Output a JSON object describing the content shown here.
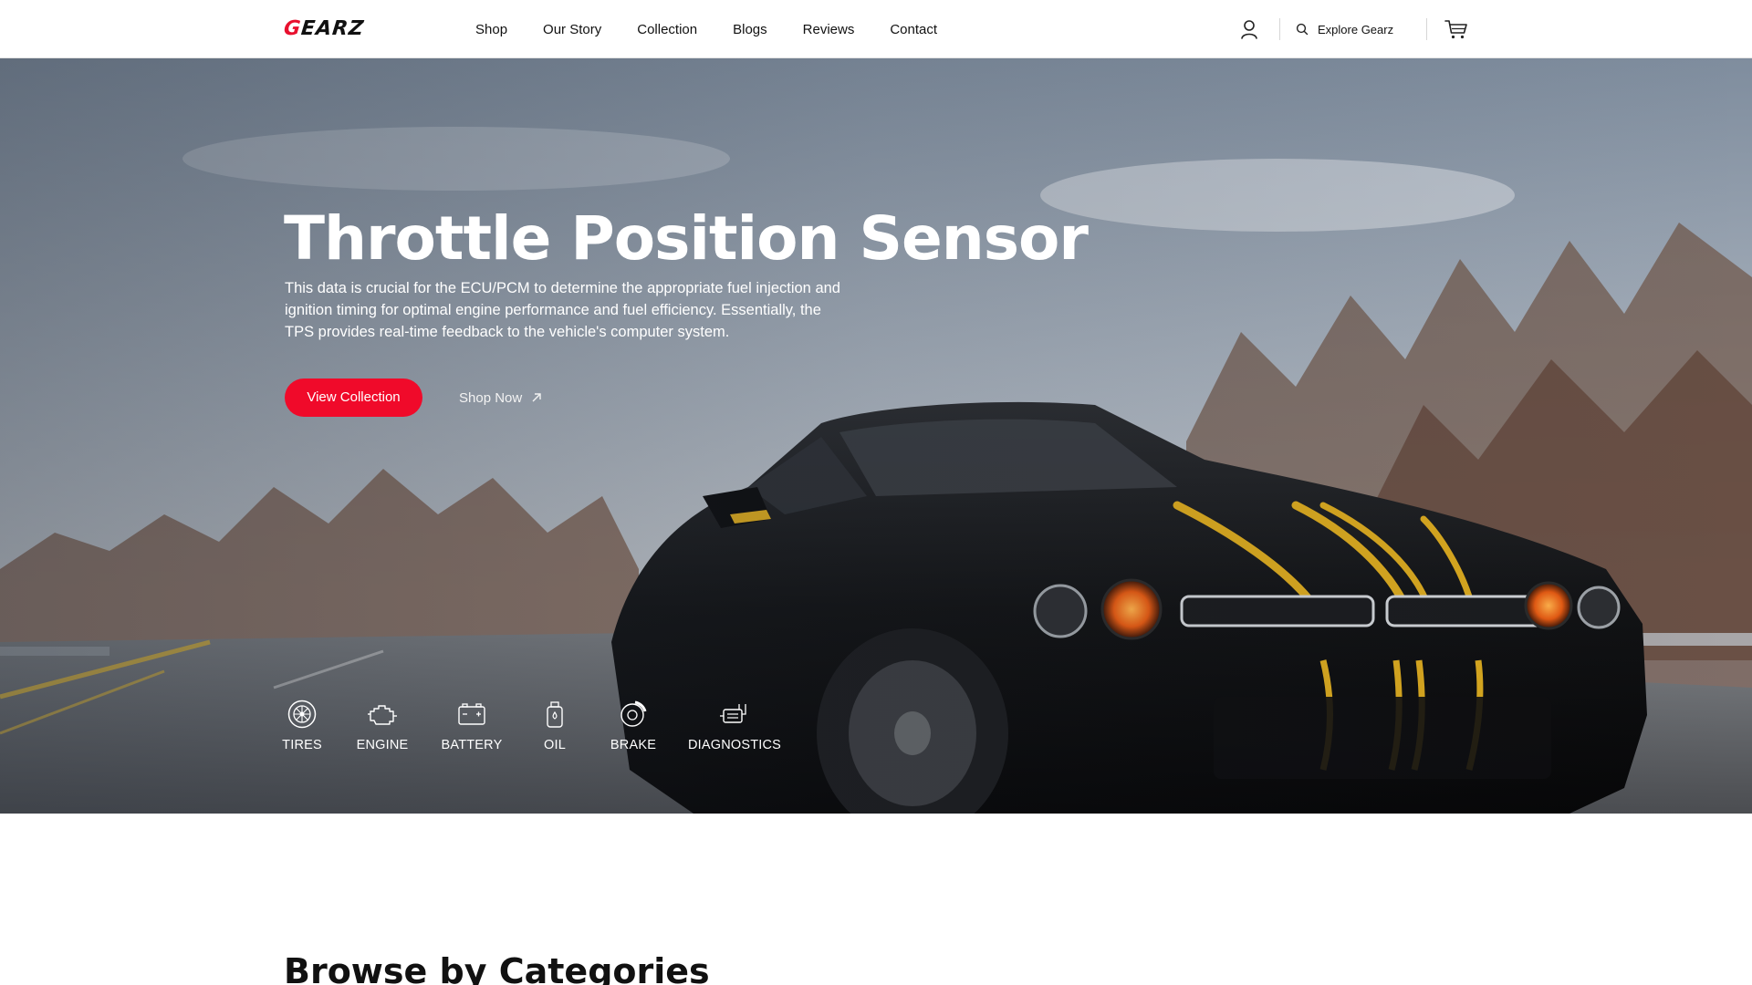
{
  "header": {
    "logo": {
      "first": "G",
      "rest": "EARZ"
    },
    "nav": [
      "Shop",
      "Our Story",
      "Collection",
      "Blogs",
      "Reviews",
      "Contact"
    ],
    "search_label": "Explore Gearz",
    "icons": {
      "account": "user-icon",
      "search": "search-icon",
      "cart": "cart-icon"
    }
  },
  "hero": {
    "title": "Throttle Position Sensor",
    "description": "This data is crucial for the ECU/PCM to determine the appropriate fuel injection and ignition timing for optimal engine performance and fuel efficiency. Essentially, the TPS provides real-time feedback to the vehicle's computer system.",
    "primary_button": "View Collection",
    "secondary_button": "Shop Now",
    "categories": [
      {
        "label": "TIRES",
        "icon": "tire-icon"
      },
      {
        "label": "ENGINE",
        "icon": "engine-icon"
      },
      {
        "label": "BATTERY",
        "icon": "battery-icon"
      },
      {
        "label": "OIL",
        "icon": "oil-icon"
      },
      {
        "label": "BRAKE",
        "icon": "brake-icon"
      },
      {
        "label": "DIAGNOSTICS",
        "icon": "diagnostics-icon"
      }
    ]
  },
  "browse": {
    "title": "Browse by Categories"
  },
  "colors": {
    "accent": "#f00a2a",
    "text": "#111111",
    "white": "#ffffff"
  }
}
